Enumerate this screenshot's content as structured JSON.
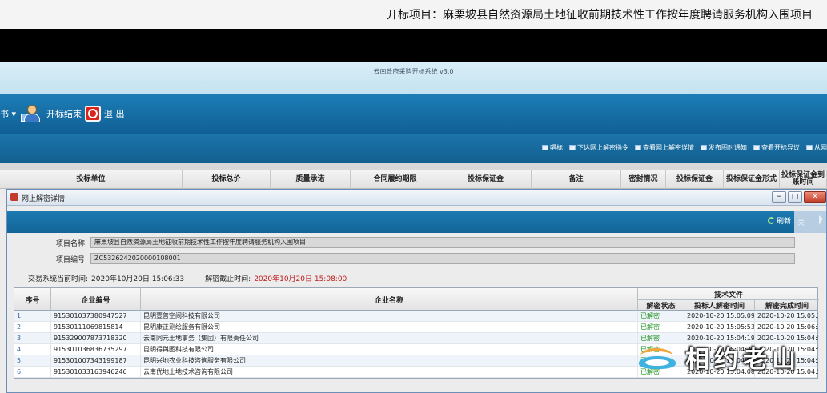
{
  "banner": {
    "title": "开标项目：麻栗坡县自然资源局土地征收前期技术性工作按年度聘请服务机构入围项目"
  },
  "app": {
    "system_name": "云南政府采购开标系统 v3.0"
  },
  "toolbar1": {
    "partial_label": "书 ▾",
    "end_label": "开标结束",
    "exit_label": "退 出"
  },
  "toolbar2": {
    "buttons": [
      "唱标",
      "下达网上解密指令",
      "查看网上解密详情",
      "发布图时通知",
      "查看开标异议",
      "从网"
    ]
  },
  "main_table": {
    "headers": [
      "投标单位",
      "投标总价",
      "质量承诺",
      "合同履约期限",
      "投标保证金",
      "备注",
      "密封情况",
      "投标保证金",
      "投标保证金形式",
      "投标保证金到账时间"
    ]
  },
  "dialog": {
    "title": "网上解密详情",
    "refresh_label": "刷新",
    "extra_label": "关",
    "minimize": "−",
    "maximize": "□",
    "close": "✕",
    "project_name_label": "项目名称:",
    "project_name": "麻栗坡县自然资源局土地征收前期技术性工作按年度聘请服务机构入围项目",
    "project_code_label": "项目编号:",
    "project_code": "ZC5326242020000108001",
    "now_label": "交易系统当前时间:",
    "now_value": "2020年10月20日 15:06:33",
    "deadline_label": "解密截止时间:",
    "deadline_value": "2020年10月20日 15:08:00",
    "columns": {
      "seq": "序号",
      "code": "企业编号",
      "name": "企业名称",
      "tech_group": "技术文件",
      "status": "解密状态",
      "decrypt_time": "投标人解密时间",
      "done_time": "解密完成时间"
    },
    "rows": [
      {
        "seq": "1",
        "code": "915301037380947527",
        "name": "昆明壹普空间科技有限公司",
        "status": "已解密",
        "decrypt_time": "2020-10-20 15:05:09",
        "done_time": "2020-10-20 15:05:31"
      },
      {
        "seq": "2",
        "code": "91530111069815814",
        "name": "昆明康正测绘服务有限公司",
        "status": "已解密",
        "decrypt_time": "2020-10-20 15:05:53",
        "done_time": "2020-10-20 15:06:30"
      },
      {
        "seq": "3",
        "code": "915329007873718320",
        "name": "云南同元土地事务（集团）有限责任公司",
        "status": "已解密",
        "decrypt_time": "2020-10-20 15:04:19",
        "done_time": "2020-10-20 15:04:53"
      },
      {
        "seq": "4",
        "code": "915301036836735297",
        "name": "昆明得舆图科技有限公司",
        "status": "已解密",
        "decrypt_time": "2020-10-20 15:04:22",
        "done_time": "2020-10-20 15:04:56"
      },
      {
        "seq": "5",
        "code": "915301007343199187",
        "name": "昆明兴地农业科技咨询服务有限公司",
        "status": "已解密",
        "decrypt_time": "2020-10-20 15:04:17",
        "done_time": "2020-10-20 15:04:31"
      },
      {
        "seq": "6",
        "code": "915301033163946246",
        "name": "云南优地土地技术咨询有限公司",
        "status": "已解密",
        "decrypt_time": "2020-10-20 15:04:08",
        "done_time": "2020-10-20 15:04:59"
      }
    ]
  },
  "watermark": {
    "text": "相约老山"
  }
}
